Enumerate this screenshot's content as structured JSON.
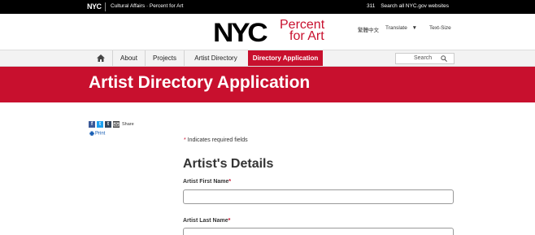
{
  "topbar": {
    "logo": "NYC",
    "breadcrumb": "Cultural Affairs · Percent for Art",
    "phone": "311",
    "search_all": "Search all NYC.gov websites"
  },
  "header": {
    "logo_nyc": "NYC",
    "logo_line1": "Percent",
    "logo_line2": "for Art",
    "language": "繁體中文",
    "translate": "Translate",
    "translate_arrow": "▼",
    "text_size": "Text-Size"
  },
  "nav": {
    "items": [
      {
        "label": "About"
      },
      {
        "label": "Projects"
      },
      {
        "label": "Artist Directory"
      },
      {
        "label": "Directory Application"
      }
    ],
    "search_placeholder": "Search"
  },
  "banner": {
    "title": "Artist Directory Application"
  },
  "share": {
    "label": "Share",
    "print": "Print"
  },
  "form": {
    "required_marker": "*",
    "required_note": " Indicates required fields",
    "section_title": "Artist's Details",
    "fields": [
      {
        "label": "Artist First Name",
        "value": ""
      },
      {
        "label": "Artist Last Name",
        "value": ""
      }
    ]
  },
  "colors": {
    "brand_red": "#c8102e",
    "topbar": "#000000",
    "nav_bg": "#f3f3f3"
  }
}
